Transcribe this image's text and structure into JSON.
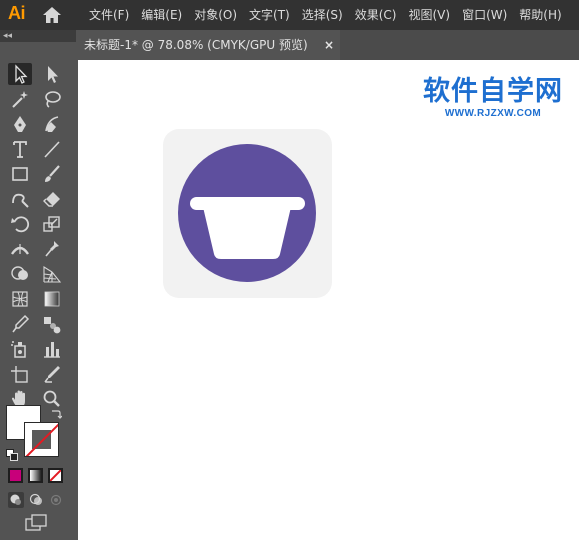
{
  "app": {
    "logo_text": "Ai",
    "brand_color": "#ff9a00"
  },
  "menu": [
    "文件(F)",
    "编辑(E)",
    "对象(O)",
    "文字(T)",
    "选择(S)",
    "效果(C)",
    "视图(V)",
    "窗口(W)",
    "帮助(H)"
  ],
  "toolbar": {
    "collapse_glyph": "◂◂",
    "tools": [
      "selection-tool",
      "direct-selection-tool",
      "magic-wand-tool",
      "lasso-tool",
      "pen-tool",
      "curvature-tool",
      "type-tool",
      "line-segment-tool",
      "rectangle-tool",
      "paintbrush-tool",
      "shaper-tool",
      "eraser-tool",
      "rotate-tool",
      "scale-tool",
      "width-tool",
      "puppet-warp-tool",
      "shape-builder-tool",
      "perspective-grid-tool",
      "mesh-tool",
      "gradient-tool",
      "eyedropper-tool",
      "blend-tool",
      "symbol-sprayer-tool",
      "column-graph-tool",
      "artboard-tool",
      "slice-tool",
      "hand-tool",
      "zoom-tool"
    ],
    "active_tool": "selection-tool"
  },
  "colors": {
    "fill": "#ffffff",
    "stroke": "#5a5a5a",
    "accent_swatch": "#c8007a"
  },
  "document_tab": {
    "title": "未标题-1* @ 78.08% (CMYK/GPU 预览)",
    "close": "×"
  },
  "artwork": {
    "background": "#f2f2f2",
    "circle": "#5e4f9e",
    "bowl": "#ffffff"
  },
  "watermark": {
    "title": "软件自学网",
    "url": "WWW.RJZXW.COM",
    "color": "#1e6fd0"
  }
}
